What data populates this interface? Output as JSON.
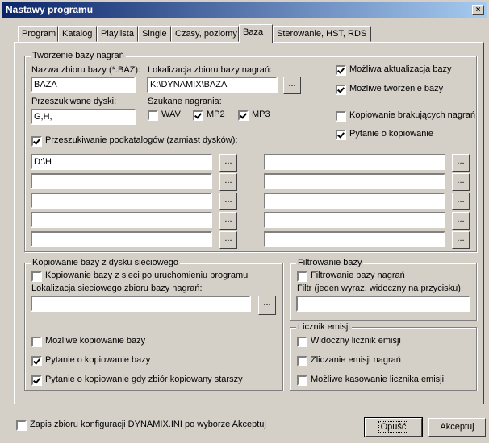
{
  "window": {
    "title": "Nastawy programu",
    "close": "×"
  },
  "tabs": [
    "Program",
    "Katalog",
    "Playlista",
    "Single",
    "Czasy, poziomy",
    "Baza",
    "Sterowanie, HST, RDS"
  ],
  "db_group": {
    "title": "Tworzenie bazy nagrań",
    "name_label": "Nazwa zbioru bazy (*.BAZ):",
    "name_value": "BAZA",
    "location_label": "Lokalizacja zbioru bazy nagrań:",
    "location_value": "K:\\DYNAMIX\\BAZA",
    "browse": "...",
    "disks_label": "Przeszukiwane dyski:",
    "disks_value": "G,H,",
    "search_label": "Szukane nagrania:",
    "wav": "WAV",
    "mp2": "MP2",
    "mp3": "MP3",
    "subdir_label": "Przeszukiwanie podkatalogów (zamiast dysków):",
    "folder1": "D:\\H",
    "opt_update": "Możliwa aktualizacja bazy",
    "opt_create": "Możliwe tworzenie bazy",
    "opt_copy_missing": "Kopiowanie brakujących nagrań",
    "opt_ask_copy": "Pytanie o kopiowanie"
  },
  "net_group": {
    "title": "Kopiowanie bazy z dysku sieciowego",
    "copy_on_start": "Kopiowanie bazy z sieci po uruchomieniu programu",
    "loc_label": "Lokalizacja sieciowego zbioru bazy nagrań:",
    "loc_value": "",
    "opt_possible": "Możliwe kopiowanie bazy",
    "opt_ask": "Pytanie o kopiowanie bazy",
    "opt_ask_older": "Pytanie o kopiowanie gdy zbiór kopiowany starszy"
  },
  "filter_group": {
    "title": "Filtrowanie bazy",
    "filter_label": "Filtrowanie bazy nagrań",
    "filter_word_label": "Filtr (jeden wyraz, widoczny na przycisku):",
    "filter_value": ""
  },
  "counter_group": {
    "title": "Licznik emisji",
    "visible": "Widoczny licznik emisji",
    "counting": "Zliczanie emisji nagrań",
    "reset": "Możliwe kasowanie licznika emisji"
  },
  "footer": {
    "save_ini": "Zapis zbioru konfiguracji DYNAMIX.INI po wyborze Akceptuj",
    "cancel": "Opuść",
    "accept": "Akceptuj"
  }
}
